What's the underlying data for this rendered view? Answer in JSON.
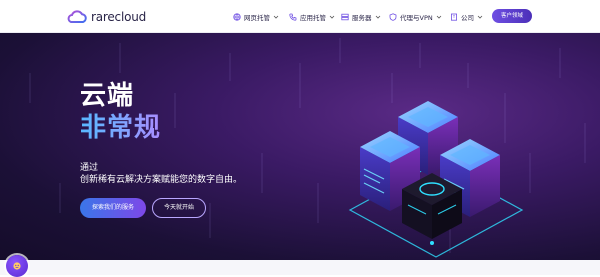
{
  "brand": {
    "name": "rarecloud"
  },
  "nav": {
    "items": [
      {
        "label": "网页托管",
        "icon": "globe-icon"
      },
      {
        "label": "应用托管",
        "icon": "phone-icon"
      },
      {
        "label": "服务器",
        "icon": "server-icon"
      },
      {
        "label": "代理与VPN",
        "icon": "shield-icon"
      },
      {
        "label": "公司",
        "icon": "building-icon"
      }
    ],
    "cta_label": "客户领域"
  },
  "hero": {
    "title_line1": "云端",
    "title_line2": "非常规",
    "subtitle_line1": "通过",
    "subtitle_line2": "创新稀有云解决方案赋能您的数字自由。",
    "primary_button": "探索我们的服务",
    "secondary_button": "今天就开始"
  },
  "colors": {
    "accent": "#6f4fe3",
    "hero_bg": "#1b1036",
    "title_gradient_start": "#58b9ff",
    "title_gradient_end": "#a98cff"
  },
  "chat_widget": {
    "icon": "chat-icon"
  }
}
